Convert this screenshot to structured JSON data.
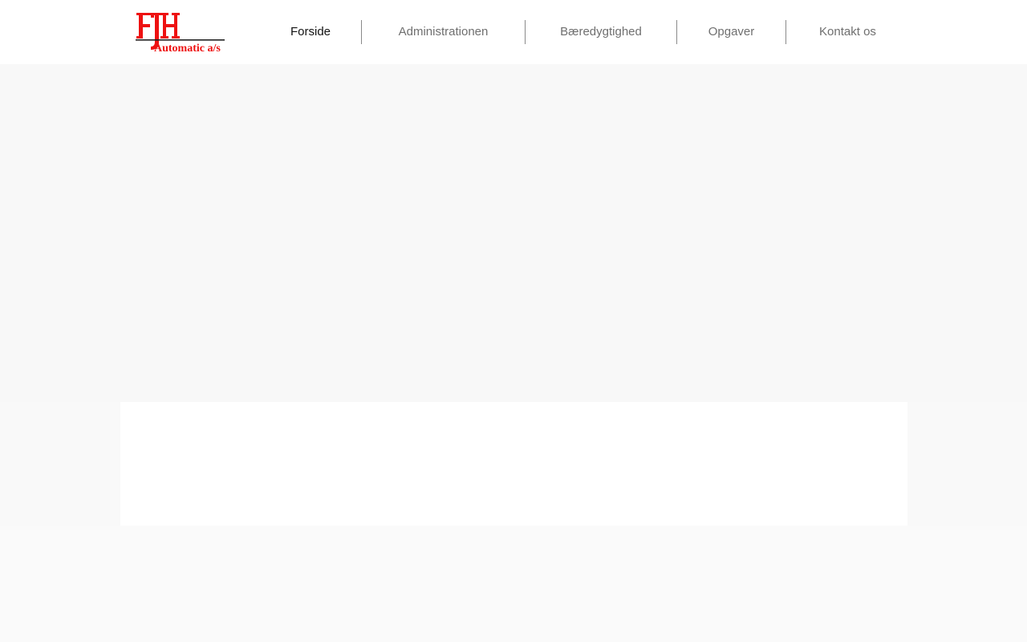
{
  "brand": {
    "logo_letters": "FJH",
    "logo_tagline": "Automatic a/s",
    "logo_color": "#ee1111",
    "line_color": "#222222"
  },
  "nav": {
    "items": [
      {
        "label": "Forside",
        "active": true
      },
      {
        "label": "Administrationen",
        "active": false
      },
      {
        "label": "Bæredygtighed",
        "active": false
      },
      {
        "label": "Opgaver",
        "active": false
      },
      {
        "label": "Kontakt os",
        "active": false
      }
    ]
  },
  "colors": {
    "header_bg": "#ffffff",
    "page_bg": "#f9f9f9",
    "nav_text": "#6f6f6f",
    "nav_active_text": "#111111",
    "separator": "#8a8a8a"
  }
}
